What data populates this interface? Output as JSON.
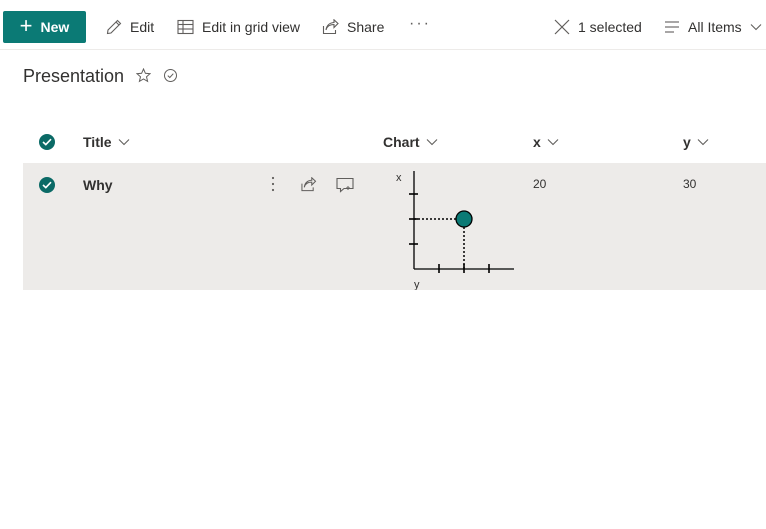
{
  "commandbar": {
    "new_label": "New",
    "edit_label": "Edit",
    "grid_label": "Edit in grid view",
    "share_label": "Share",
    "more_label": "···",
    "selected_label": "1 selected",
    "view_label": "All Items"
  },
  "page": {
    "title": "Presentation"
  },
  "columns": {
    "title": "Title",
    "chart": "Chart",
    "x": "x",
    "y": "y"
  },
  "rows": [
    {
      "title": "Why",
      "x": "20",
      "y": "30",
      "selected": true
    }
  ],
  "chart_data": {
    "type": "scatter",
    "xlabel": "x",
    "ylabel": "y",
    "points": [
      {
        "x": 2,
        "y": 2
      }
    ],
    "xlim": [
      0,
      4
    ],
    "ylim": [
      0,
      4
    ],
    "colors": {
      "point": "#0b7a75"
    }
  },
  "colors": {
    "accent": "#0b7a75",
    "row_selected_bg": "#edebe9"
  }
}
